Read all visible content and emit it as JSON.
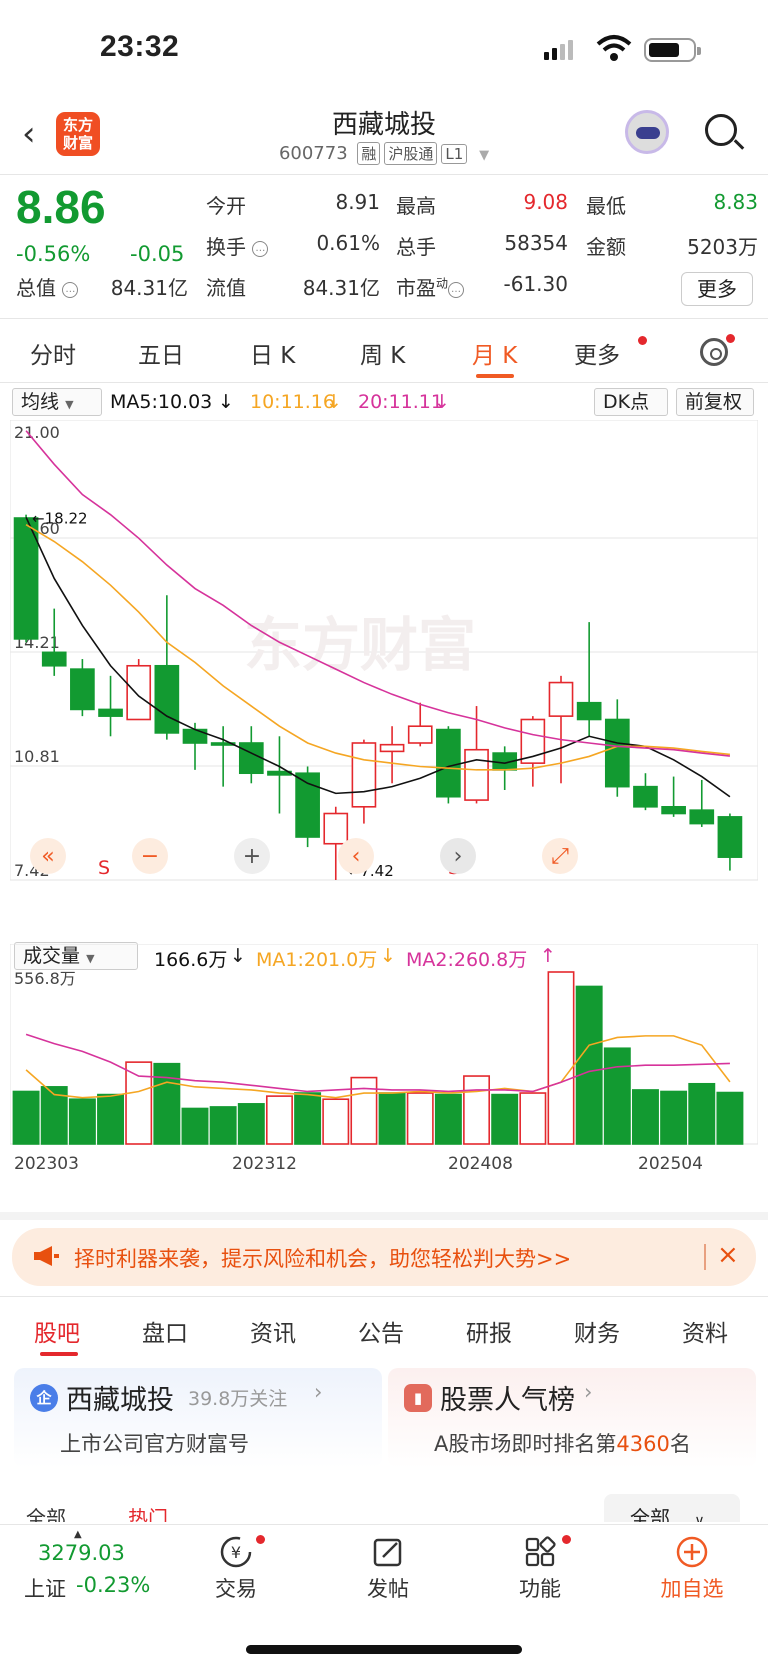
{
  "status": {
    "time": "23:32"
  },
  "header": {
    "back_icon": "chevron-left-icon",
    "logo_text_1": "东方",
    "logo_text_2": "财富",
    "name": "西藏城投",
    "code": "600773",
    "tags": [
      "融",
      "沪股通",
      "L1"
    ]
  },
  "quote": {
    "price": "8.86",
    "pct": "-0.56%",
    "change": "-0.05",
    "open_label": "今开",
    "open": "8.91",
    "high_label": "最高",
    "high": "9.08",
    "low_label": "最低",
    "low": "8.83",
    "turnover_label": "换手",
    "turnover": "0.61%",
    "volume_label": "总手",
    "volume": "58354",
    "amount_label": "金额",
    "amount": "5203万",
    "mktcap_label": "总值",
    "mktcap": "84.31亿",
    "float_label": "流值",
    "float_cap": "84.31亿",
    "pe_label": "市盈",
    "pe_sup": "动",
    "pe": "-61.30",
    "more_button": "更多",
    "colors": {
      "down": "#129a31",
      "up": "#e4282d"
    }
  },
  "period_tabs": [
    "分时",
    "五日",
    "日 K",
    "周 K",
    "月 K",
    "更多"
  ],
  "active_period": "月 K",
  "ma_legend": {
    "selector": "均线",
    "ma5": "MA5:10.03",
    "ma10": "10:11.16",
    "ma20": "20:11.11",
    "dk_button": "DK点",
    "adjust_button": "前复权"
  },
  "chart_data": [
    {
      "type": "candlestick",
      "title": "",
      "ylim": [
        7.42,
        21.0
      ],
      "y_labels": [
        "21.00",
        "17.60",
        "14.21",
        "10.81",
        "7.42"
      ],
      "annotations": [
        "←18.22",
        "←7.42"
      ],
      "watermark": "东方财富",
      "controls": [
        "«",
        "S",
        "−",
        "+",
        "‹",
        "S",
        "›",
        "⤢"
      ],
      "candles": [
        {
          "o": 18.2,
          "c": 14.6,
          "h": 18.3,
          "l": 14.5
        },
        {
          "o": 14.2,
          "c": 13.8,
          "h": 15.5,
          "l": 13.5
        },
        {
          "o": 13.7,
          "c": 12.5,
          "h": 14.0,
          "l": 12.3
        },
        {
          "o": 12.5,
          "c": 12.3,
          "h": 13.5,
          "l": 11.7
        },
        {
          "o": 12.2,
          "c": 13.8,
          "h": 14.0,
          "l": 12.2
        },
        {
          "o": 13.8,
          "c": 11.8,
          "h": 15.9,
          "l": 11.6
        },
        {
          "o": 11.9,
          "c": 11.5,
          "h": 12.1,
          "l": 10.7
        },
        {
          "o": 11.5,
          "c": 11.45,
          "h": 12.0,
          "l": 10.2
        },
        {
          "o": 11.5,
          "c": 10.6,
          "h": 12.0,
          "l": 10.3
        },
        {
          "o": 10.65,
          "c": 10.55,
          "h": 11.7,
          "l": 9.4
        },
        {
          "o": 10.6,
          "c": 8.7,
          "h": 10.8,
          "l": 8.4
        },
        {
          "o": 8.5,
          "c": 9.4,
          "h": 9.6,
          "l": 7.42
        },
        {
          "o": 9.6,
          "c": 11.5,
          "h": 11.6,
          "l": 9.1
        },
        {
          "o": 11.25,
          "c": 11.45,
          "h": 12.0,
          "l": 10.3
        },
        {
          "o": 11.5,
          "c": 12.0,
          "h": 12.7,
          "l": 11.4
        },
        {
          "o": 11.9,
          "c": 9.9,
          "h": 12.0,
          "l": 9.7
        },
        {
          "o": 9.8,
          "c": 11.3,
          "h": 12.6,
          "l": 9.7
        },
        {
          "o": 11.2,
          "c": 10.7,
          "h": 11.4,
          "l": 10.1
        },
        {
          "o": 10.9,
          "c": 12.2,
          "h": 12.3,
          "l": 10.2
        },
        {
          "o": 12.3,
          "c": 13.3,
          "h": 13.5,
          "l": 10.3
        },
        {
          "o": 12.7,
          "c": 12.2,
          "h": 15.1,
          "l": 11.7
        },
        {
          "o": 12.2,
          "c": 10.2,
          "h": 12.8,
          "l": 9.9
        },
        {
          "o": 10.2,
          "c": 9.6,
          "h": 10.6,
          "l": 9.5
        },
        {
          "o": 9.6,
          "c": 9.4,
          "h": 10.5,
          "l": 9.3
        },
        {
          "o": 9.5,
          "c": 9.1,
          "h": 10.4,
          "l": 9.0
        },
        {
          "o": 9.3,
          "c": 8.1,
          "h": 9.4,
          "l": 7.7
        }
      ],
      "series": [
        {
          "name": "MA5",
          "color": "#111111",
          "values": [
            18.22,
            16.4,
            15.0,
            13.8,
            12.9,
            12.3,
            11.9,
            11.6,
            11.2,
            10.8,
            10.3,
            10.0,
            10.05,
            10.2,
            10.45,
            10.8,
            11.0,
            10.9,
            11.1,
            11.35,
            11.7,
            11.5,
            11.4,
            11.0,
            10.5,
            9.9
          ]
        },
        {
          "name": "10",
          "color": "#f5a623",
          "values": [
            18.0,
            17.5,
            16.9,
            16.2,
            15.4,
            14.5,
            13.9,
            13.2,
            12.6,
            12.0,
            11.5,
            11.2,
            11.0,
            10.9,
            10.8,
            10.75,
            10.7,
            10.7,
            10.75,
            10.9,
            11.1,
            11.4,
            11.4,
            11.35,
            11.25,
            11.16
          ]
        },
        {
          "name": "20",
          "color": "#d6339b",
          "values": [
            20.8,
            19.8,
            18.9,
            18.3,
            17.6,
            16.8,
            16.1,
            15.6,
            15.0,
            14.5,
            14.1,
            13.7,
            13.3,
            12.95,
            12.65,
            12.4,
            12.2,
            11.95,
            11.75,
            11.6,
            11.5,
            11.4,
            11.35,
            11.3,
            11.2,
            11.11
          ]
        }
      ]
    },
    {
      "type": "bar",
      "title": "",
      "ylim": [
        0,
        556.8
      ],
      "y_labels": [
        "556.8万"
      ],
      "x_labels": [
        "202303",
        "202312",
        "202408",
        "202504"
      ],
      "values": [
        170,
        185,
        145,
        160,
        265,
        260,
        115,
        120,
        130,
        155,
        165,
        145,
        215,
        165,
        165,
        160,
        220,
        160,
        165,
        556.8,
        510,
        310,
        175,
        170,
        195,
        166.6
      ],
      "up": [
        false,
        false,
        false,
        false,
        true,
        false,
        false,
        false,
        false,
        true,
        false,
        true,
        true,
        false,
        true,
        false,
        true,
        false,
        true,
        true,
        false,
        false,
        false,
        false,
        false,
        false
      ],
      "series": [
        {
          "name": "MA1",
          "color": "#f5a623",
          "values": [
            240,
            160,
            150,
            155,
            170,
            200,
            185,
            180,
            175,
            165,
            160,
            150,
            165,
            165,
            170,
            165,
            170,
            180,
            170,
            200,
            320,
            345,
            350,
            350,
            320,
            201
          ]
        },
        {
          "name": "MA2",
          "color": "#d6339b",
          "values": [
            355,
            325,
            300,
            265,
            220,
            215,
            205,
            200,
            190,
            180,
            170,
            175,
            180,
            175,
            175,
            170,
            175,
            175,
            170,
            200,
            235,
            250,
            255,
            255,
            258,
            260.8
          ]
        }
      ]
    }
  ],
  "vol_legend": {
    "selector": "成交量",
    "vol": "166.6万",
    "ma1": "MA1:201.0万",
    "ma2": "MA2:260.8万"
  },
  "banner": {
    "text": "择时利器来袭，提示风险和机会，助您轻松判大势>>",
    "close": "×"
  },
  "sub_tabs": [
    "股吧",
    "盘口",
    "资讯",
    "公告",
    "研报",
    "财务",
    "资料"
  ],
  "cards": {
    "left_title": "西藏城投",
    "left_follow": "39.8万关注",
    "left_sub": "上市公司官方财富号",
    "left_icon": "企",
    "right_title": "股票人气榜",
    "right_sub_pre": "A股市场即时排名第",
    "right_rank": "4360",
    "right_sub_post": "名"
  },
  "filter_tabs": [
    "全部",
    "热门",
    "全部"
  ],
  "bottom": {
    "index_value": "3279.03",
    "index_name": "上证",
    "index_change": "-0.23%",
    "nav": [
      "交易",
      "发帖",
      "功能",
      "加自选"
    ]
  }
}
